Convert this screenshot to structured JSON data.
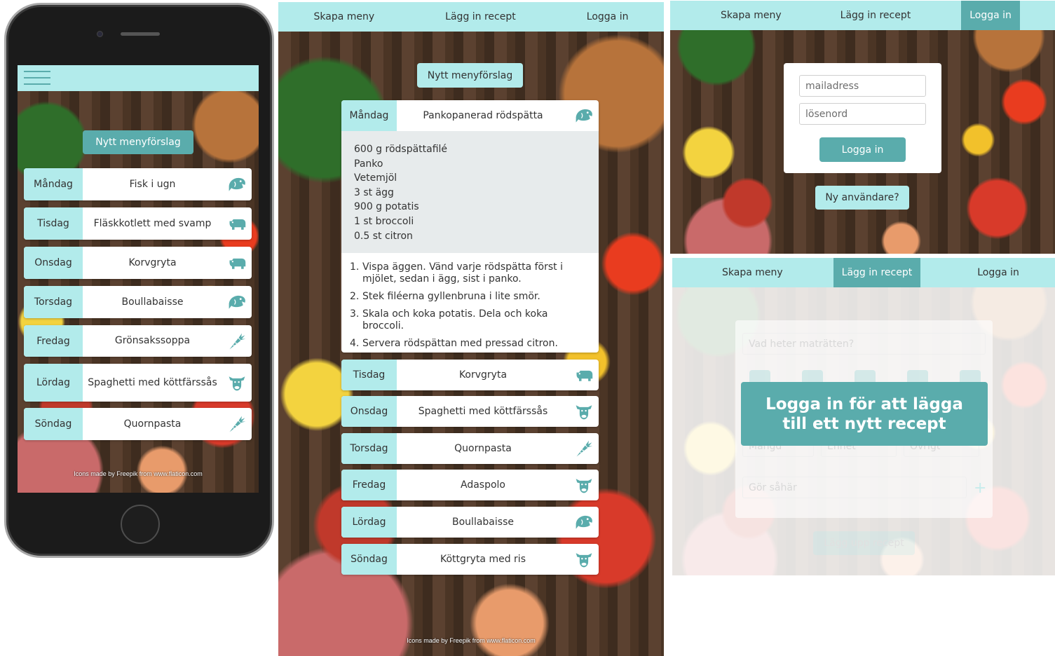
{
  "colors": {
    "light_teal": "#b2ebeb",
    "dark_teal": "#5aacac",
    "grey_panel": "#e7ebec"
  },
  "nav": {
    "create_menu": "Skapa meny",
    "add_recipe": "Lägg in recept",
    "login": "Logga in"
  },
  "credits": "Icons made by Freepik from www.flaticon.com",
  "phone": {
    "new_menu_button": "Nytt menyförslag",
    "days": [
      {
        "day": "Måndag",
        "dish": "Fisk i ugn",
        "icon": "fish-icon"
      },
      {
        "day": "Tisdag",
        "dish": "Fläskkotlett med svamp",
        "icon": "pig-icon"
      },
      {
        "day": "Onsdag",
        "dish": "Korvgryta",
        "icon": "pig-icon"
      },
      {
        "day": "Torsdag",
        "dish": "Boullabaisse",
        "icon": "fish-icon"
      },
      {
        "day": "Fredag",
        "dish": "Grönsakssoppa",
        "icon": "carrot-icon"
      },
      {
        "day": "Lördag",
        "dish": "Spaghetti med köttfärssås",
        "icon": "cow-icon"
      },
      {
        "day": "Söndag",
        "dish": "Quornpasta",
        "icon": "carrot-icon"
      }
    ]
  },
  "tablet": {
    "new_menu_button": "Nytt menyförslag",
    "expanded": {
      "day": "Måndag",
      "dish": "Pankopanerad rödspätta",
      "icon": "fish-icon",
      "ingredients": [
        "600 g rödspättafilé",
        "Panko",
        "Vetemjöl",
        "3 st ägg",
        "900 g potatis",
        "1 st broccoli",
        "0.5 st citron"
      ],
      "steps": [
        "Vispa äggen. Vänd varje rödspätta först i mjölet, sedan i ägg, sist i panko.",
        "Stek filéerna gyllenbruna i lite smör.",
        "Skala och koka potatis. Dela och koka broccoli.",
        "Servera rödspättan med pressad citron."
      ]
    },
    "days": [
      {
        "day": "Tisdag",
        "dish": "Korvgryta",
        "icon": "pig-icon"
      },
      {
        "day": "Onsdag",
        "dish": "Spaghetti med köttfärssås",
        "icon": "cow-icon"
      },
      {
        "day": "Torsdag",
        "dish": "Quornpasta",
        "icon": "carrot-icon"
      },
      {
        "day": "Fredag",
        "dish": "Adaspolo",
        "icon": "cow-icon"
      },
      {
        "day": "Lördag",
        "dish": "Boullabaisse",
        "icon": "fish-icon"
      },
      {
        "day": "Söndag",
        "dish": "Köttgryta med ris",
        "icon": "cow-icon"
      }
    ]
  },
  "login_view": {
    "email_placeholder": "mailadress",
    "password_placeholder": "lösenord",
    "login_button": "Logga in",
    "new_user_button": "Ny användare?"
  },
  "add_recipe_view": {
    "recipe_name_placeholder": "Vad heter maträtten?",
    "amount_placeholder": "Mängd",
    "unit_placeholder": "Enhet",
    "ingredient_placeholder": "Övrigt",
    "instructions_placeholder": "Gör såhär",
    "submit_button": "Lägg upp recept",
    "overlay_message": "Logga in för att lägga till ett nytt recept"
  }
}
